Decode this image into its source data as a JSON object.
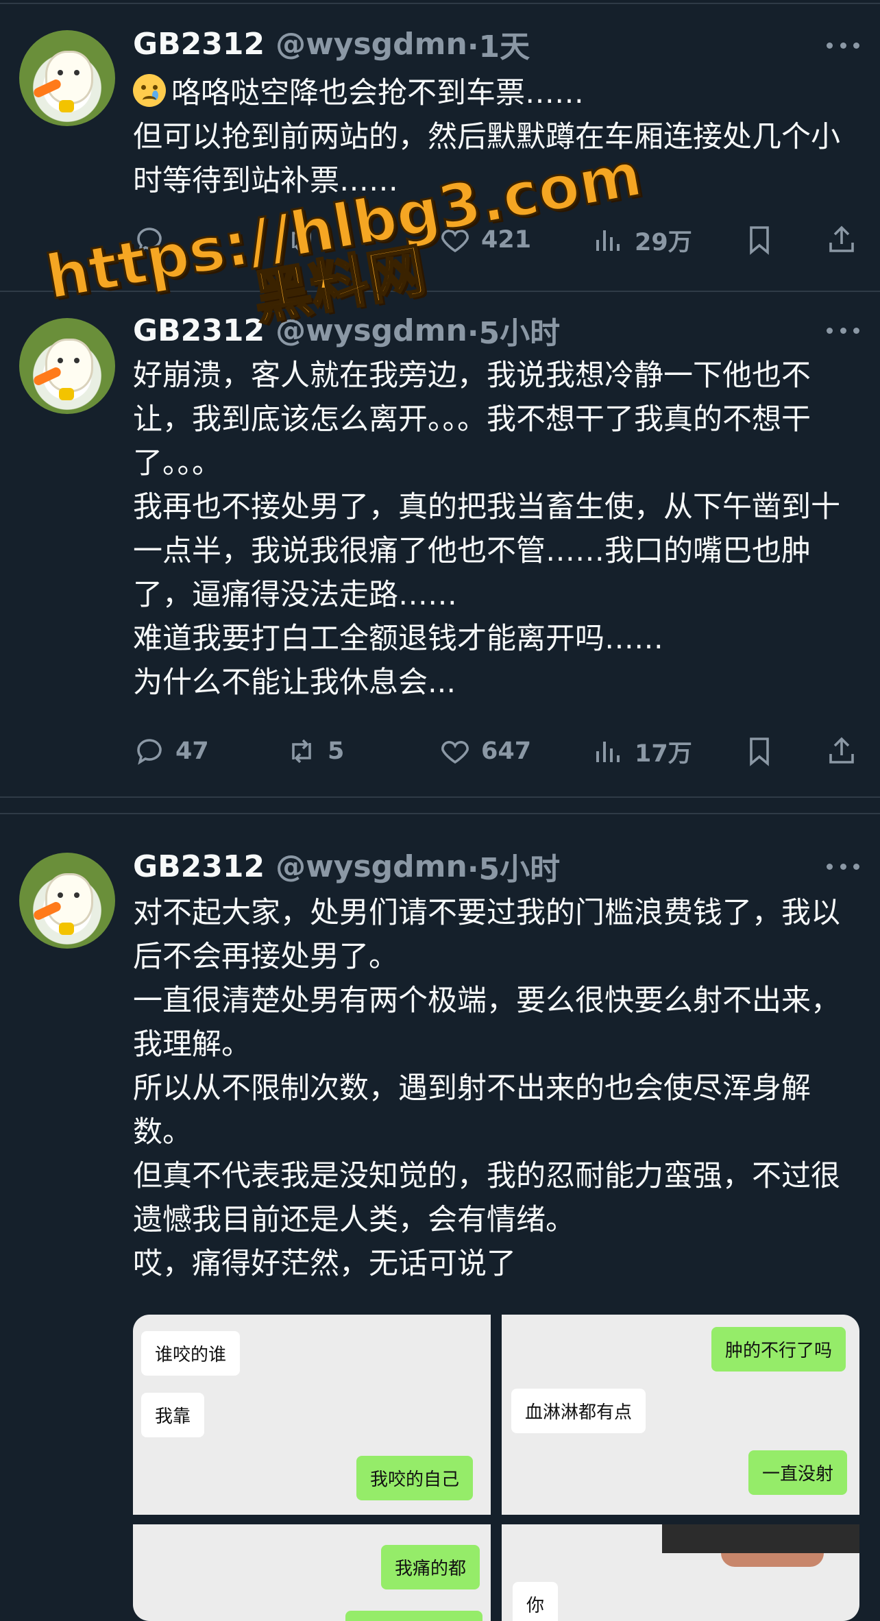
{
  "tweets": [
    {
      "name": "GB2312",
      "handle": "@wysgdmn",
      "time": "·1天",
      "lines": [
        "咯咯哒空降也会抢不到车票……",
        "但可以抢到前两站的，然后默默蹲在车厢连接处几个小时等待到站补票……"
      ],
      "replies": "",
      "retweets": "",
      "likes": "421",
      "views": "29万"
    },
    {
      "name": "GB2312",
      "handle": "@wysgdmn",
      "time": "·5小时",
      "lines": [
        "好崩溃，客人就在我旁边，我说我想冷静一下他也不让，我到底该怎么离开。。。我不想干了我真的不想干了。。。",
        "我再也不接处男了，真的把我当畜生使，从下午凿到十一点半，我说我很痛了他也不管……我口的嘴巴也肿了，逼痛得没法走路……",
        "难道我要打白工全额退钱才能离开吗……",
        "为什么不能让我休息会..."
      ],
      "replies": "47",
      "retweets": "5",
      "likes": "647",
      "views": "17万"
    },
    {
      "name": "GB2312",
      "handle": "@wysgdmn",
      "time": "·5小时",
      "lines": [
        "对不起大家，处男们请不要过我的门槛浪费钱了，我以后不会再接处男了。",
        "一直很清楚处男有两个极端，要么很快要么射不出来，我理解。",
        "所以从不限制次数，遇到射不出来的也会使尽浑身解数。",
        "但真不代表我是没知觉的，我的忍耐能力蛮强，不过很遗憾我目前还是人类，会有情绪。",
        "哎，痛得好茫然，无话可说了"
      ]
    }
  ],
  "chats": {
    "img1": [
      "谁咬的谁",
      "我靠",
      "我咬的自己"
    ],
    "img2": [
      "肿的不行了吗",
      "血淋淋都有点",
      "一直没射"
    ],
    "img3": [
      "我痛的都"
    ],
    "img4": [
      "你"
    ]
  },
  "watermark": {
    "url": "https://hlbg3.com",
    "site": "黑料网"
  },
  "colors": {
    "background": "#15202b",
    "text": "#f7f9f9",
    "muted": "#8b98a5",
    "divider": "#2f3b47",
    "chat_right": "#95ec69",
    "watermark": "#f5a623"
  }
}
